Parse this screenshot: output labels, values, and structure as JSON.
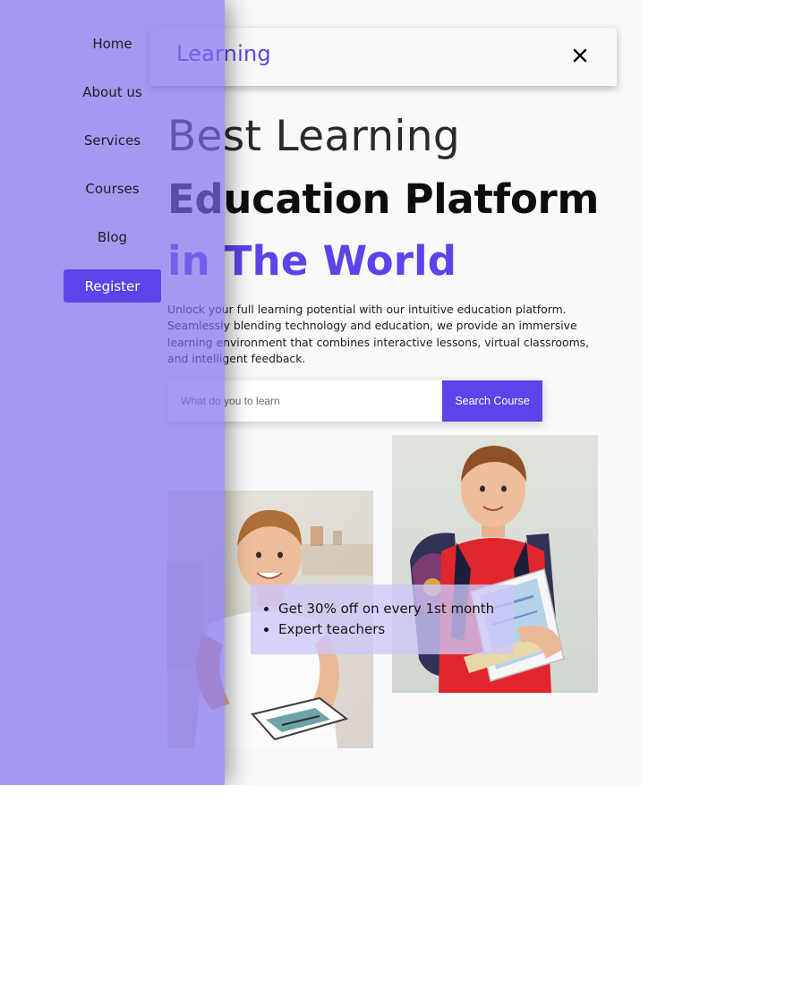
{
  "header": {
    "logo": "Learning",
    "close_icon": "close-icon"
  },
  "hero": {
    "line1": "Best Learning",
    "line2": "Education Platform",
    "line3": "in The World",
    "description": "Unlock your full learning potential with our intuitive education platform. Seamlessly blending technology and education, we provide an immersive learning environment that combines interactive lessons, virtual classrooms, and intelligent feedback."
  },
  "search": {
    "placeholder": "What do you to learn",
    "button_label": "Search Course"
  },
  "offer": {
    "items": [
      "Get 30% off on every 1st month",
      "Expert teachers"
    ]
  },
  "sidebar": {
    "items": [
      {
        "label": "Home"
      },
      {
        "label": "About us"
      },
      {
        "label": "Services"
      },
      {
        "label": "Courses"
      },
      {
        "label": "Blog"
      }
    ],
    "register_label": "Register"
  },
  "colors": {
    "accent": "#5b44ea",
    "overlay": "#7c6cee",
    "page_bg": "#f9f9f9"
  }
}
